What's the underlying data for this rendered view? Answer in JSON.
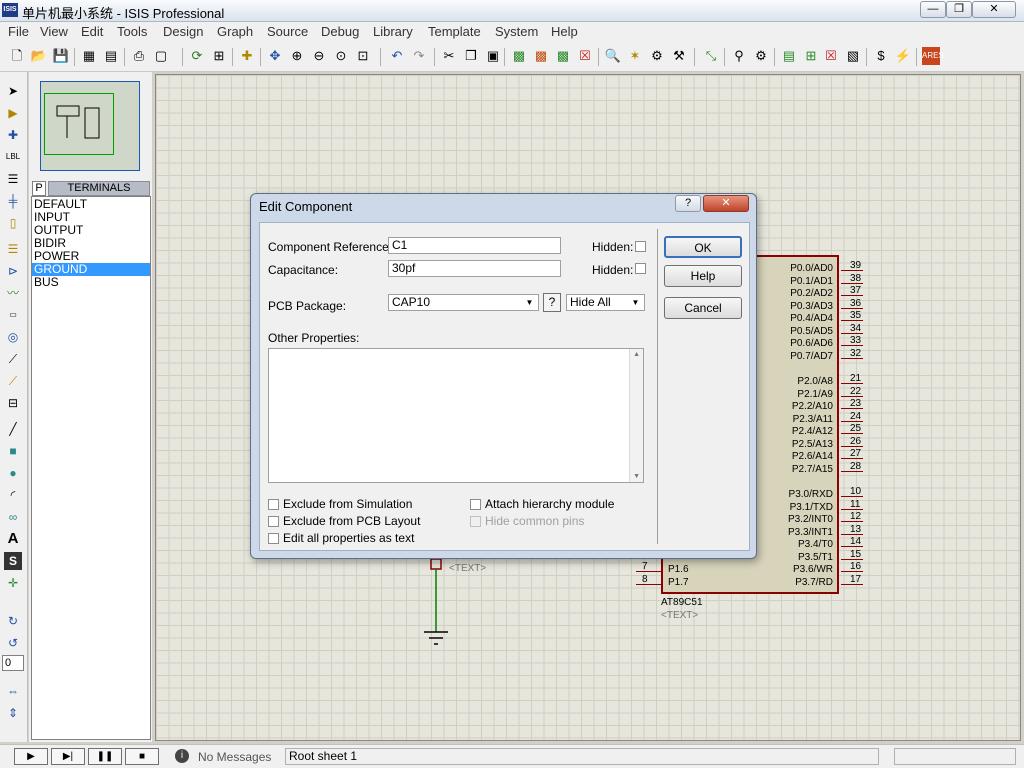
{
  "title": "单片机最小系统 - ISIS Professional",
  "app_icon": "ISIS",
  "window_controls": [
    "—",
    "❐",
    "✕"
  ],
  "menu": [
    "File",
    "View",
    "Edit",
    "Tools",
    "Design",
    "Graph",
    "Source",
    "Debug",
    "Library",
    "Template",
    "System",
    "Help"
  ],
  "terminals": {
    "mode_button": "P",
    "header": "TERMINALS",
    "items": [
      "DEFAULT",
      "INPUT",
      "OUTPUT",
      "BIDIR",
      "POWER",
      "GROUND",
      "BUS"
    ],
    "selected": "GROUND"
  },
  "rotation_value": "0",
  "status": {
    "message_icon": "info-icon",
    "messages": "No Messages",
    "sheet": "Root sheet 1"
  },
  "schematic": {
    "chip_name": "AT89C51",
    "chip_text": "<TEXT>",
    "cap_text": "<TEXT>",
    "port0": [
      [
        "P0.0/AD0",
        "39"
      ],
      [
        "P0.1/AD1",
        "38"
      ],
      [
        "P0.2/AD2",
        "37"
      ],
      [
        "P0.3/AD3",
        "36"
      ],
      [
        "P0.4/AD4",
        "35"
      ],
      [
        "P0.5/AD5",
        "34"
      ],
      [
        "P0.6/AD6",
        "33"
      ],
      [
        "P0.7/AD7",
        "32"
      ]
    ],
    "port2": [
      [
        "P2.0/A8",
        "21"
      ],
      [
        "P2.1/A9",
        "22"
      ],
      [
        "P2.2/A10",
        "23"
      ],
      [
        "P2.3/A11",
        "24"
      ],
      [
        "P2.4/A12",
        "25"
      ],
      [
        "P2.5/A13",
        "26"
      ],
      [
        "P2.6/A14",
        "27"
      ],
      [
        "P2.7/A15",
        "28"
      ]
    ],
    "port3": [
      [
        "P3.0/RXD",
        "10"
      ],
      [
        "P3.1/TXD",
        "11"
      ],
      [
        "P3.2/INT0",
        "12"
      ],
      [
        "P3.3/INT1",
        "13"
      ],
      [
        "P3.4/T0",
        "14"
      ],
      [
        "P3.5/T1",
        "15"
      ],
      [
        "P3.6/WR",
        "16"
      ],
      [
        "P3.7/RD",
        "17"
      ]
    ],
    "left_pins": [
      [
        "P1.6",
        "7"
      ],
      [
        "P1.7",
        "8"
      ]
    ]
  },
  "dialog": {
    "title": "Edit Component",
    "help_glyph": "?",
    "close_glyph": "✕",
    "ref_label": "Component Reference:",
    "ref_value": "C1",
    "cap_label": "Capacitance:",
    "cap_value": "30pf",
    "hidden_label": "Hidden:",
    "pcb_label": "PCB Package:",
    "pcb_value": "CAP10",
    "pcb_q": "?",
    "hide_value": "Hide All",
    "other_label": "Other Properties:",
    "other_value": "",
    "ok": "OK",
    "help": "Help",
    "cancel": "Cancel",
    "exclude_sim": "Exclude from Simulation",
    "exclude_pcb": "Exclude from PCB Layout",
    "edit_all": "Edit all properties as text",
    "attach": "Attach hierarchy module",
    "hide_pins": "Hide common pins"
  }
}
